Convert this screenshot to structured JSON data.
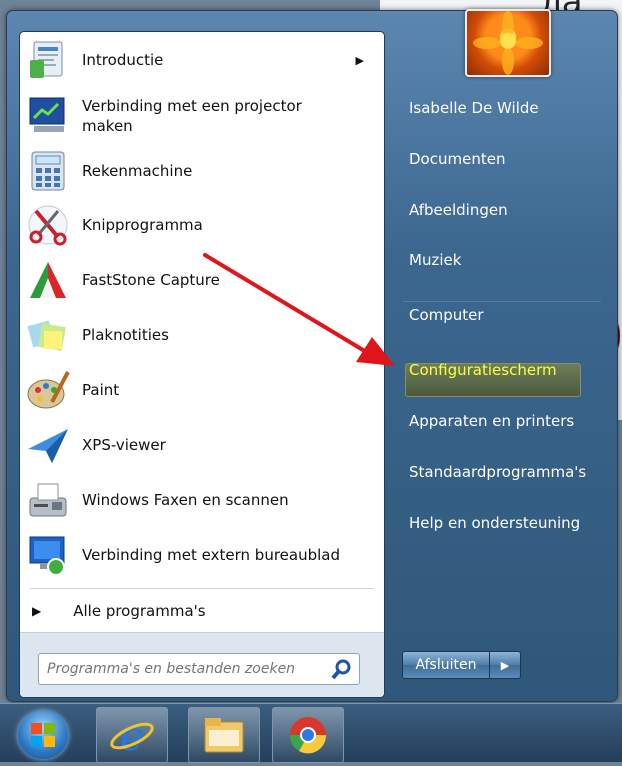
{
  "left_menu": {
    "programs": [
      {
        "label": "Introductie",
        "icon": "introductie-icon",
        "has_submenu": true
      },
      {
        "label": "Verbinding met een projector\nmaken",
        "icon": "projector-icon"
      },
      {
        "label": "Rekenmachine",
        "icon": "calculator-icon"
      },
      {
        "label": "Knipprogramma",
        "icon": "scissors-icon"
      },
      {
        "label": "FastStone Capture",
        "icon": "faststone-icon"
      },
      {
        "label": "Plaknotities",
        "icon": "sticky-notes-icon"
      },
      {
        "label": "Paint",
        "icon": "paint-palette-icon"
      },
      {
        "label": "XPS-viewer",
        "icon": "xps-viewer-icon"
      },
      {
        "label": "Windows Faxen en scannen",
        "icon": "fax-scanner-icon"
      },
      {
        "label": "Verbinding met extern bureaublad",
        "icon": "remote-desktop-icon"
      }
    ],
    "all_programs": "Alle programma's",
    "search_placeholder": "Programma's en bestanden zoeken"
  },
  "right_menu": {
    "items": [
      {
        "label": "Isabelle De Wilde"
      },
      {
        "label": "Documenten"
      },
      {
        "label": "Afbeeldingen"
      },
      {
        "label": "Muziek"
      },
      {
        "label": "Computer"
      },
      {
        "label": "Configuratiescherm",
        "highlighted": true,
        "color": "#ffff3b"
      },
      {
        "label": "Apparaten en printers"
      },
      {
        "label": "Standaardprogramma's"
      },
      {
        "label": "Help en ondersteuning"
      }
    ],
    "shutdown_label": "Afsluiten"
  },
  "taskbar": {
    "buttons": [
      "start-orb",
      "internet-explorer-icon",
      "file-explorer-icon",
      "chrome-icon"
    ]
  },
  "colors": {
    "annotation_arrow": "#e0151b",
    "highlight_text": "#ffff3b"
  }
}
